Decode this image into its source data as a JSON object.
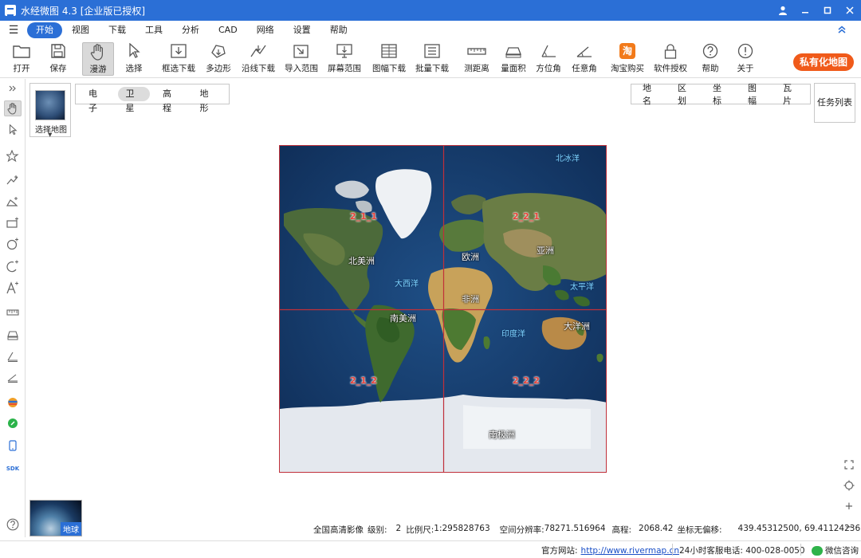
{
  "window": {
    "title": "水经微图 4.3 [企业版已授权]"
  },
  "menu": {
    "items": [
      "开始",
      "视图",
      "下载",
      "工具",
      "分析",
      "CAD",
      "网络",
      "设置",
      "帮助"
    ],
    "active": "开始"
  },
  "toolbar": {
    "items": [
      {
        "label": "打开",
        "icon": "folder-icon"
      },
      {
        "label": "保存",
        "icon": "save-icon"
      },
      {
        "label": "漫游",
        "icon": "hand-icon",
        "pressed": true
      },
      {
        "label": "选择",
        "icon": "cursor-icon"
      },
      {
        "label": "框选下载",
        "icon": "box-download-icon"
      },
      {
        "label": "多边形",
        "icon": "polygon-icon"
      },
      {
        "label": "沿线下载",
        "icon": "line-download-icon"
      },
      {
        "label": "导入范围",
        "icon": "import-range-icon"
      },
      {
        "label": "屏幕范围",
        "icon": "screen-range-icon"
      },
      {
        "label": "图幅下载",
        "icon": "sheet-download-icon"
      },
      {
        "label": "批量下载",
        "icon": "batch-download-icon"
      },
      {
        "label": "测距离",
        "icon": "ruler-icon"
      },
      {
        "label": "量面积",
        "icon": "area-icon"
      },
      {
        "label": "方位角",
        "icon": "azimuth-icon"
      },
      {
        "label": "任意角",
        "icon": "angle-icon"
      },
      {
        "label": "淘宝购买",
        "icon": "taobao-icon"
      },
      {
        "label": "软件授权",
        "icon": "lock-icon"
      },
      {
        "label": "帮助",
        "icon": "help-icon"
      },
      {
        "label": "关于",
        "icon": "info-icon"
      }
    ],
    "private_map": "私有化地图",
    "taobao_glyph": "淘"
  },
  "mapview": {
    "select_map_label": "选择地图",
    "map_types": [
      "电子",
      "卫星",
      "高程",
      "地形"
    ],
    "active_map_type": "卫星",
    "layers": [
      "地名",
      "区划",
      "坐标",
      "图幅",
      "瓦片"
    ],
    "task_list": "任务列表",
    "earth_label": "地球",
    "tile_labels": [
      "2_1_1",
      "2_2_1",
      "2_1_2",
      "2_2_2"
    ],
    "continents": [
      "北美洲",
      "欧洲",
      "亚洲",
      "非洲",
      "南美洲",
      "大洋洲",
      "南极洲"
    ],
    "oceans": [
      "北冰洋",
      "大西洋",
      "太平洋",
      "印度洋"
    ]
  },
  "status": {
    "source": "全国高清影像",
    "level_label": "级别:",
    "level": "2",
    "scale_label": "比例尺:",
    "scale": "1:295828763",
    "resolution_label": "空间分辨率:",
    "resolution": "78271.516964",
    "elevation_label": "高程:",
    "elevation": "2068.42",
    "offset_label": "坐标无偏移:",
    "coords": "439.45312500, 69.41124236"
  },
  "footer": {
    "website_label": "官方网站:",
    "website": "http://www.rivermap.cn",
    "phone": "24小时客服电话: 400-028-0050",
    "wechat": "微信咨询"
  }
}
